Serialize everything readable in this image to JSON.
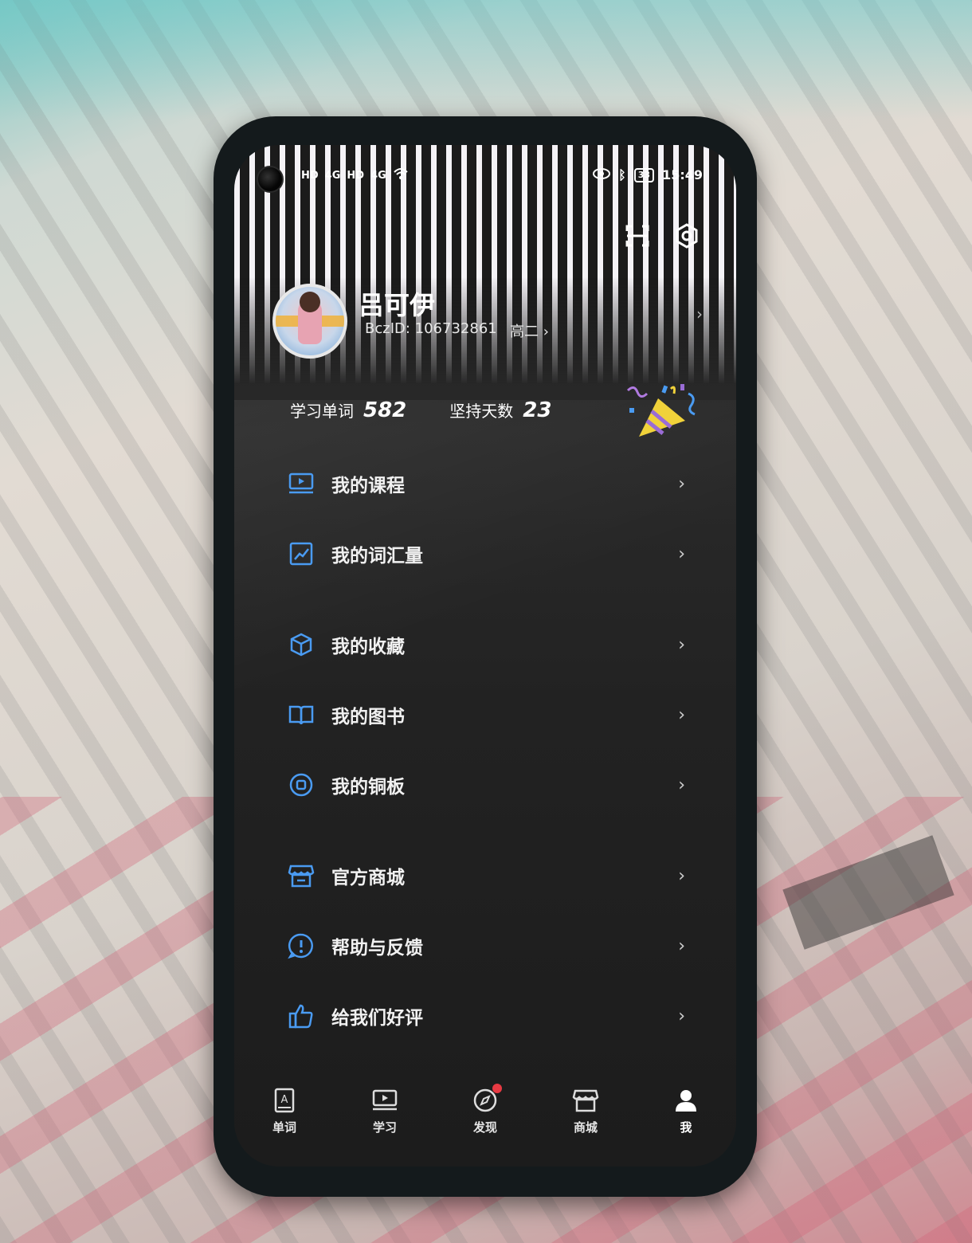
{
  "status_bar": {
    "left_items": [
      "HD",
      "4G",
      "HD",
      "4G"
    ],
    "battery": "33",
    "time": "15:49"
  },
  "header": {
    "scan_icon": "scan-icon",
    "settings_icon": "settings-hex-icon"
  },
  "profile": {
    "name": "吕可伊",
    "bczid": "BczID: 106732861",
    "grade": "高二 ›"
  },
  "stats": {
    "words_label": "学习单词",
    "words_value": "582",
    "days_label": "坚持天数",
    "days_value": "23"
  },
  "menu": {
    "items": [
      {
        "label": "我的课程",
        "icon": "video-course-icon"
      },
      {
        "label": "我的词汇量",
        "icon": "trend-chart-icon"
      },
      {
        "label": "我的收藏",
        "icon": "cube-icon"
      },
      {
        "label": "我的图书",
        "icon": "book-open-icon"
      },
      {
        "label": "我的铜板",
        "icon": "coin-icon"
      },
      {
        "label": "官方商城",
        "icon": "store-icon"
      },
      {
        "label": "帮助与反馈",
        "icon": "help-alert-icon"
      },
      {
        "label": "给我们好评",
        "icon": "thumbs-up-icon"
      }
    ]
  },
  "tabs": {
    "items": [
      {
        "label": "单词",
        "icon": "word-book-icon"
      },
      {
        "label": "学习",
        "icon": "video-icon"
      },
      {
        "label": "发现",
        "icon": "compass-icon"
      },
      {
        "label": "商城",
        "icon": "store-icon"
      },
      {
        "label": "我",
        "icon": "person-icon"
      }
    ]
  },
  "colors": {
    "accent": "#4a9bf2",
    "badge": "#e83a43"
  }
}
